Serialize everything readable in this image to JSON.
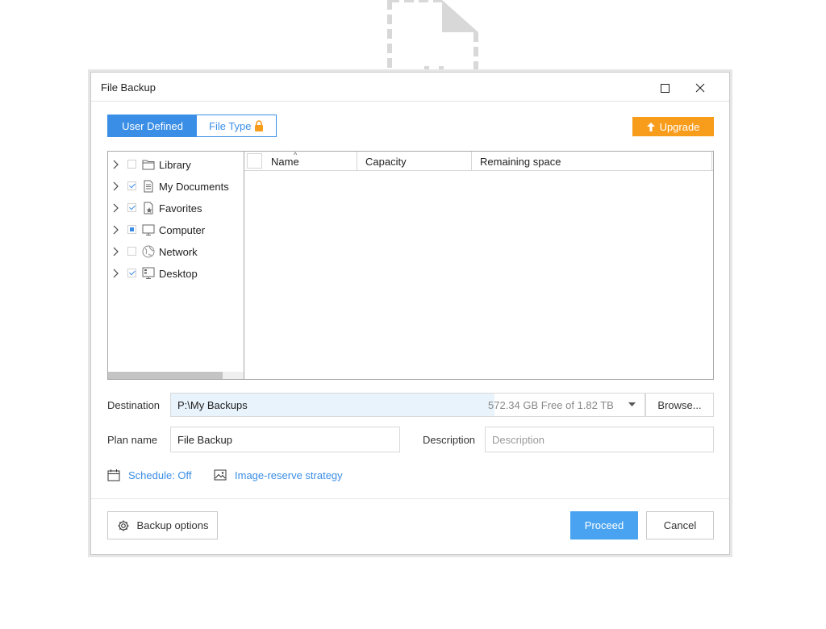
{
  "window": {
    "title": "File Backup"
  },
  "tabs": [
    {
      "label": "User Defined",
      "active": true
    },
    {
      "label": "File Type",
      "active": false,
      "icon": "lock-icon"
    }
  ],
  "upgrade": {
    "label": "Upgrade",
    "icon": "arrow-up-icon",
    "color": "#f89c1c"
  },
  "tree": {
    "items": [
      {
        "label": "Library",
        "checked": "none",
        "icon": "folder-icon"
      },
      {
        "label": "My Documents",
        "checked": "checked",
        "icon": "document-icon"
      },
      {
        "label": "Favorites",
        "checked": "checked",
        "icon": "favorites-icon"
      },
      {
        "label": "Computer",
        "checked": "partial",
        "icon": "computer-icon"
      },
      {
        "label": "Network",
        "checked": "none",
        "icon": "network-icon"
      },
      {
        "label": "Desktop",
        "checked": "checked",
        "icon": "desktop-icon"
      }
    ]
  },
  "list": {
    "columns": [
      "Name",
      "Capacity",
      "Remaining space"
    ],
    "sort_indicator": "^"
  },
  "destination": {
    "label": "Destination",
    "path": "P:\\My Backups",
    "free": "572.34 GB Free of 1.82 TB",
    "browse_label": "Browse..."
  },
  "plan": {
    "label": "Plan name",
    "value": "File Backup"
  },
  "description": {
    "label": "Description",
    "placeholder": "Description"
  },
  "links": {
    "schedule": "Schedule: Off",
    "image_reserve": "Image-reserve strategy"
  },
  "footer": {
    "options_label": "Backup options",
    "proceed_label": "Proceed",
    "cancel_label": "Cancel"
  },
  "colors": {
    "accent": "#3a8ee6",
    "proceed": "#4aa3f0",
    "upgrade": "#f89c1c"
  }
}
